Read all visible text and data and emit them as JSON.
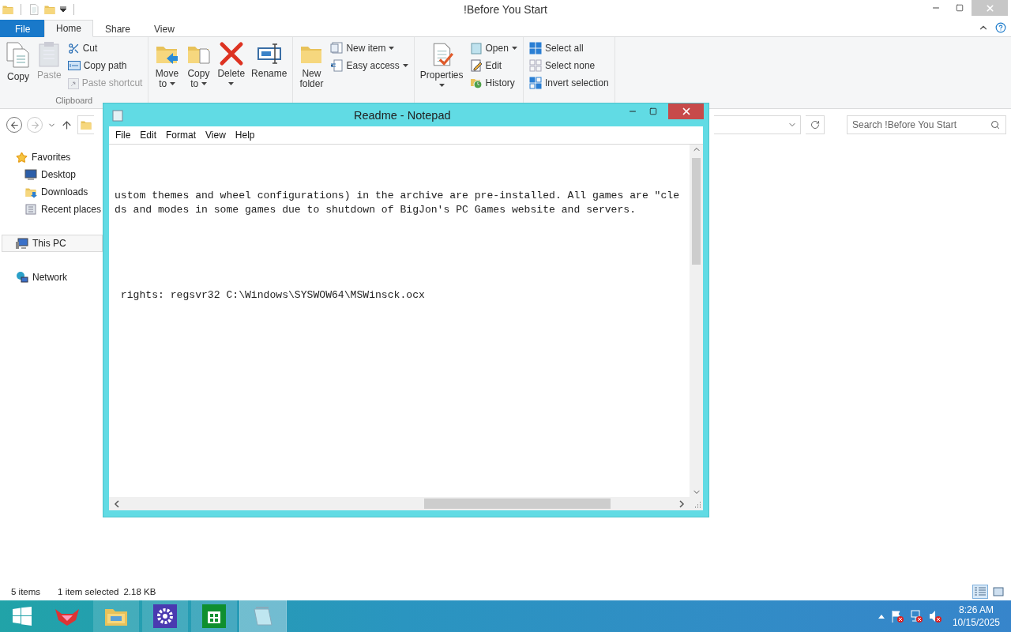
{
  "explorer": {
    "title": "!Before You Start",
    "tabs": [
      {
        "label": "File",
        "kind": "file",
        "selected": false
      },
      {
        "label": "Home",
        "kind": "tab",
        "selected": true
      },
      {
        "label": "Share",
        "kind": "tab",
        "selected": false
      },
      {
        "label": "View",
        "kind": "tab",
        "selected": false
      }
    ],
    "ribbon": [
      {
        "label": "Clipboard",
        "buttons": [
          {
            "label": "Copy",
            "kind": "large",
            "disabled": false,
            "dropdown": false
          },
          {
            "label": "Paste",
            "kind": "large",
            "disabled": true,
            "dropdown": false
          },
          {
            "label": "Cut",
            "kind": "small",
            "disabled": false,
            "dropdown": false
          },
          {
            "label": "Copy path",
            "kind": "small",
            "disabled": false,
            "dropdown": false
          },
          {
            "label": "Paste shortcut",
            "kind": "small",
            "disabled": true,
            "dropdown": false
          }
        ]
      },
      {
        "buttons": [
          {
            "label": "Move to",
            "kind": "large",
            "disabled": false,
            "dropdown": true
          },
          {
            "label": "Copy to",
            "kind": "large",
            "disabled": false,
            "dropdown": true
          },
          {
            "label": "Delete",
            "kind": "large",
            "disabled": false,
            "dropdown": true
          },
          {
            "label": "Rename",
            "kind": "large",
            "disabled": false,
            "dropdown": false
          }
        ]
      },
      {
        "buttons": [
          {
            "label": "New folder",
            "kind": "large",
            "disabled": false,
            "dropdown": false
          },
          {
            "label": "New item",
            "kind": "small",
            "disabled": false,
            "dropdown": true
          },
          {
            "label": "Easy access",
            "kind": "small",
            "disabled": false,
            "dropdown": true
          }
        ]
      },
      {
        "buttons": [
          {
            "label": "Properties",
            "kind": "large",
            "disabled": false,
            "dropdown": true
          },
          {
            "label": "Open",
            "kind": "small",
            "disabled": false,
            "dropdown": true
          },
          {
            "label": "Edit",
            "kind": "small",
            "disabled": false,
            "dropdown": false
          },
          {
            "label": "History",
            "kind": "small",
            "disabled": false,
            "dropdown": false
          }
        ]
      },
      {
        "buttons": [
          {
            "label": "Select all",
            "kind": "small",
            "disabled": false,
            "dropdown": false
          },
          {
            "label": "Select none",
            "kind": "small",
            "disabled": false,
            "dropdown": false
          },
          {
            "label": "Invert selection",
            "kind": "small",
            "disabled": false,
            "dropdown": false
          }
        ]
      }
    ],
    "search": {
      "placeholder": "Search !Before You Start"
    },
    "nav": [
      {
        "label": "Favorites",
        "selected": false,
        "children": [
          {
            "label": "Desktop",
            "selected": false
          },
          {
            "label": "Downloads",
            "selected": false
          },
          {
            "label": "Recent places",
            "selected": false
          }
        ]
      },
      {
        "label": "This PC",
        "selected": true
      },
      {
        "label": "Network",
        "selected": false
      }
    ],
    "status": [
      "5 items",
      "1 item selected",
      "2.18 KB"
    ],
    "views": [
      {
        "kind": "details",
        "selected": true
      },
      {
        "kind": "large-icons",
        "selected": false
      }
    ]
  },
  "notepad": {
    "title": "Readme - Notepad",
    "menu": [
      "File",
      "Edit",
      "Format",
      "View",
      "Help"
    ],
    "blocks": [
      [
        "ustom themes and wheel configurations) in the archive are pre-installed. All games are \"cle",
        "ds and modes in some games due to shutdown of BigJon's PC Games website and servers."
      ],
      [
        " rights: regsvr32 C:\\Windows\\SYSWOW64\\MSWinsck.ocx"
      ]
    ]
  },
  "taskbar": {
    "apps": [
      {
        "kind": "fox",
        "selected": false
      },
      {
        "kind": "explorer",
        "selected": false
      },
      {
        "kind": "settings",
        "selected": false
      },
      {
        "kind": "store",
        "selected": false
      },
      {
        "kind": "notepad",
        "selected": true
      }
    ],
    "time": "8:26 AM",
    "date": "10/15/2025"
  }
}
